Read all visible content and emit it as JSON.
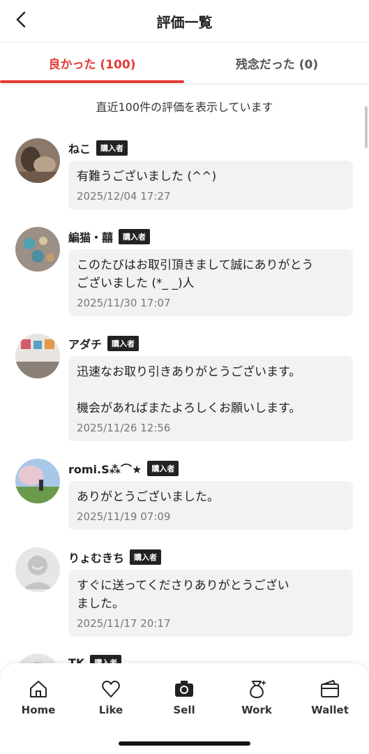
{
  "header": {
    "title": "評価一覧",
    "back_icon": "chevron-left-icon"
  },
  "tabs": [
    {
      "label": "良かった (100)",
      "active": true
    },
    {
      "label": "残念だった (0)",
      "active": false
    }
  ],
  "summary": "直近100件の評価を表示しています",
  "badge_label": "購入者",
  "reviews": [
    {
      "name": "ねこ",
      "comment": "有難うございました (^^)",
      "date": "2025/12/04 17:27"
    },
    {
      "name": "編猫・囍",
      "comment": "このたびはお取引頂きまして誠にありがとう\nございました (*_ _)人",
      "date": "2025/11/30 17:07"
    },
    {
      "name": "アダチ",
      "comment": "迅速なお取り引きありがとうございます。\n\n機会があればまたよろしくお願いします。",
      "date": "2025/11/26 12:56"
    },
    {
      "name": "romi.S⁂⌒★",
      "comment": "ありがとうございました。",
      "date": "2025/11/19 07:09"
    },
    {
      "name": "りょむきち",
      "comment": "すぐに送ってくださりありがとうござい\nました。",
      "date": "2025/11/17 20:17"
    },
    {
      "name": "TK",
      "comment": "",
      "date": ""
    }
  ],
  "nav": [
    {
      "label": "Home",
      "icon": "home-icon"
    },
    {
      "label": "Like",
      "icon": "heart-icon"
    },
    {
      "label": "Sell",
      "icon": "camera-icon"
    },
    {
      "label": "Work",
      "icon": "money-bag-icon"
    },
    {
      "label": "Wallet",
      "icon": "wallet-icon"
    }
  ],
  "colors": {
    "accent": "#e53935",
    "bubble": "#f2f2f2",
    "badge": "#222222"
  }
}
